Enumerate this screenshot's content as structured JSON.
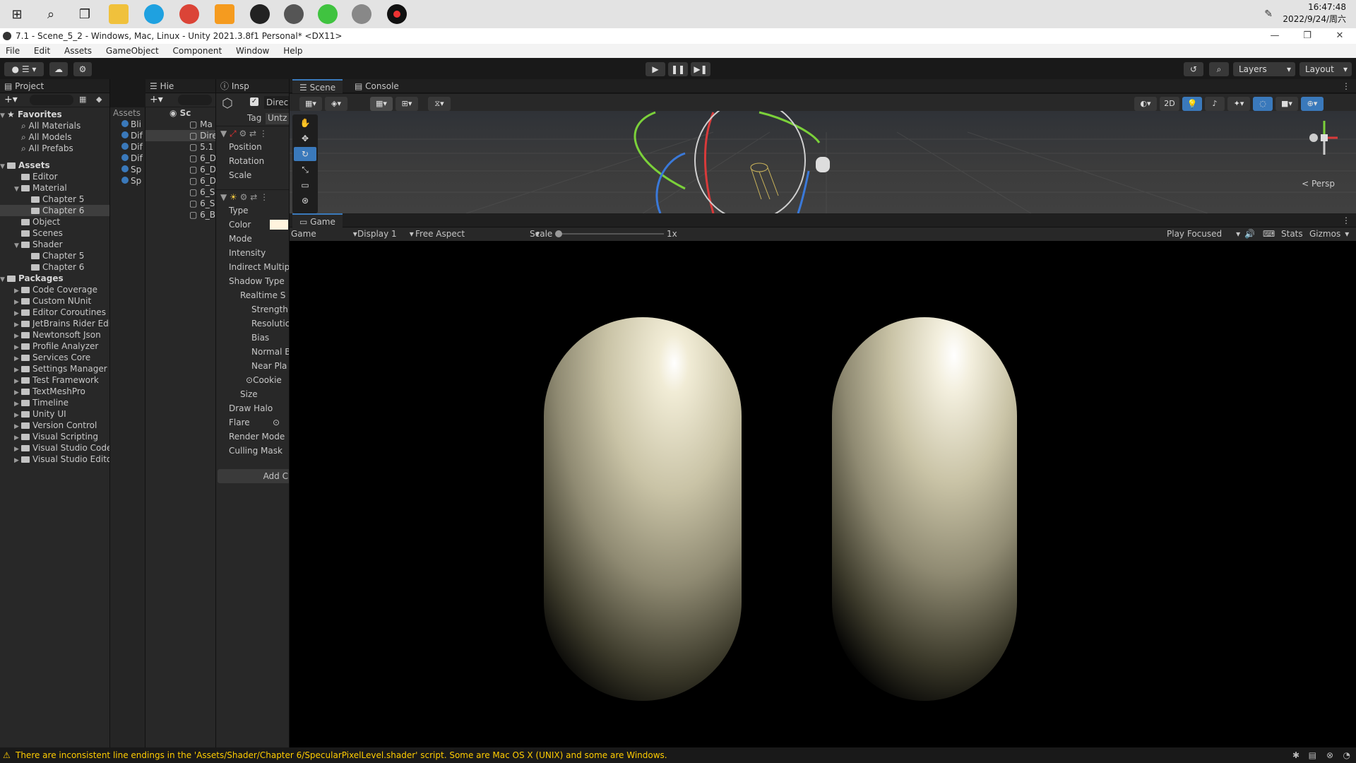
{
  "taskbar": {
    "time": "16:47:48",
    "date": "2022/9/24/周六"
  },
  "window": {
    "title": "7.1 - Scene_5_2 - Windows, Mac, Linux - Unity 2021.3.8f1 Personal* <DX11>"
  },
  "menu": [
    "File",
    "Edit",
    "Assets",
    "GameObject",
    "Component",
    "Window",
    "Help"
  ],
  "toolbar": {
    "layers_label": "Layers",
    "layout_label": "Layout"
  },
  "project": {
    "tab_label": "Project",
    "favorites_label": "Favorites",
    "favorites": [
      "All Materials",
      "All Models",
      "All Prefabs"
    ],
    "assets_label": "Assets",
    "assets_tree": [
      "Editor",
      "Material",
      "Chapter 5",
      "Chapter 6",
      "Object",
      "Scenes",
      "Shader",
      "Chapter 5",
      "Chapter 6"
    ],
    "packages_label": "Packages",
    "packages": [
      "Code Coverage",
      "Custom NUnit",
      "Editor Coroutines",
      "JetBrains Rider Edi",
      "Newtonsoft Json",
      "Profile Analyzer",
      "Services Core",
      "Settings Manager",
      "Test Framework",
      "TextMeshPro",
      "Timeline",
      "Unity UI",
      "Version Control",
      "Visual Scripting",
      "Visual Studio Code",
      "Visual Studio Editor"
    ],
    "assets_column_header": "Assets",
    "asset_items": [
      "Bli",
      "Dif",
      "Dif",
      "Dif",
      "Sp",
      "Sp"
    ]
  },
  "hierarchy": {
    "tab_label": "Hie",
    "scene_label": "Sc",
    "items": [
      "Ma",
      "Dire",
      "5.1",
      "6_D",
      "6_D",
      "6_D",
      "6_S",
      "6_S",
      "6_B"
    ]
  },
  "inspector": {
    "tab_label": "Insp",
    "object_name": "Direc",
    "tag_label": "Tag",
    "tag_value": "Untz",
    "transform_rows": [
      "Position",
      "Rotation",
      "Scale"
    ],
    "light_rows": [
      "Type",
      "Color",
      "Mode",
      "Intensity",
      "Indirect Multip",
      "Shadow Type",
      "Realtime S",
      "Strength",
      "Resolutic",
      "Bias",
      "Normal B",
      "Near Pla",
      "Cookie",
      "Size",
      "Draw Halo",
      "Flare",
      "Render Mode",
      "Culling Mask"
    ],
    "add_button": "Add C"
  },
  "scene": {
    "tab_scene": "Scene",
    "tab_console": "Console",
    "mode_2d": "2D",
    "persp_label": "< Persp"
  },
  "game": {
    "tab_label": "Game",
    "dropdown_game": "Game",
    "display": "Display 1",
    "aspect": "Free Aspect",
    "scale_label": "Scale",
    "scale_value": "1x",
    "play_focused": "Play Focused",
    "stats": "Stats",
    "gizmos": "Gizmos"
  },
  "status": {
    "message": "There are inconsistent line endings in the 'Assets/Shader/Chapter 6/SpecularPixelLevel.shader' script. Some are Mac OS X (UNIX) and some are Windows."
  },
  "colors": {
    "accent": "#3a79bb",
    "warning": "#ffcc00",
    "capsule": "#c9c3a6"
  }
}
